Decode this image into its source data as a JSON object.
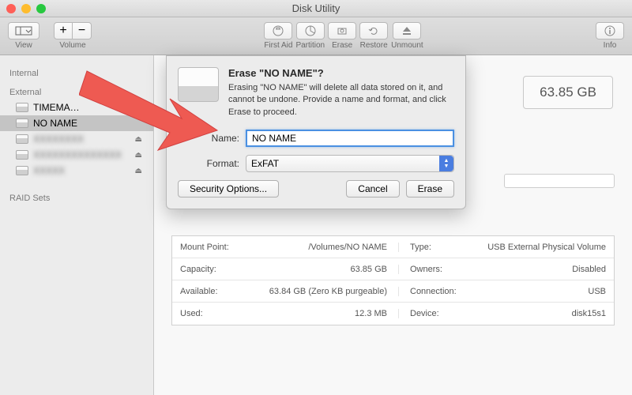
{
  "titlebar": {
    "title": "Disk Utility"
  },
  "toolbar": {
    "view_label": "View",
    "volume_label": "Volume",
    "firstaid_label": "First Aid",
    "partition_label": "Partition",
    "erase_label": "Erase",
    "restore_label": "Restore",
    "unmount_label": "Unmount",
    "info_label": "Info"
  },
  "sidebar": {
    "heading_internal": "Internal",
    "heading_external": "External",
    "heading_raid": "RAID Sets",
    "items": [
      {
        "label": "TIMEMA…"
      },
      {
        "label": "NO NAME"
      },
      {
        "label": "blurred"
      },
      {
        "label": "blurred"
      },
      {
        "label": "blurred"
      }
    ]
  },
  "content": {
    "size_badge": "63.85 GB"
  },
  "info": {
    "rows": [
      {
        "l1": "Mount Point:",
        "v1": "/Volumes/NO NAME",
        "l2": "Type:",
        "v2": "USB External Physical Volume"
      },
      {
        "l1": "Capacity:",
        "v1": "63.85 GB",
        "l2": "Owners:",
        "v2": "Disabled"
      },
      {
        "l1": "Available:",
        "v1": "63.84 GB (Zero KB purgeable)",
        "l2": "Connection:",
        "v2": "USB"
      },
      {
        "l1": "Used:",
        "v1": "12.3 MB",
        "l2": "Device:",
        "v2": "disk15s1"
      }
    ]
  },
  "dialog": {
    "title": "Erase \"NO NAME\"?",
    "desc": "Erasing \"NO NAME\" will delete all data stored on it, and cannot be undone. Provide a name and format, and click Erase to proceed.",
    "name_label": "Name:",
    "name_value": "NO NAME",
    "format_label": "Format:",
    "format_value": "ExFAT",
    "security_btn": "Security Options...",
    "cancel_btn": "Cancel",
    "erase_btn": "Erase"
  },
  "colors": {
    "arrow": "#ee5a52"
  }
}
